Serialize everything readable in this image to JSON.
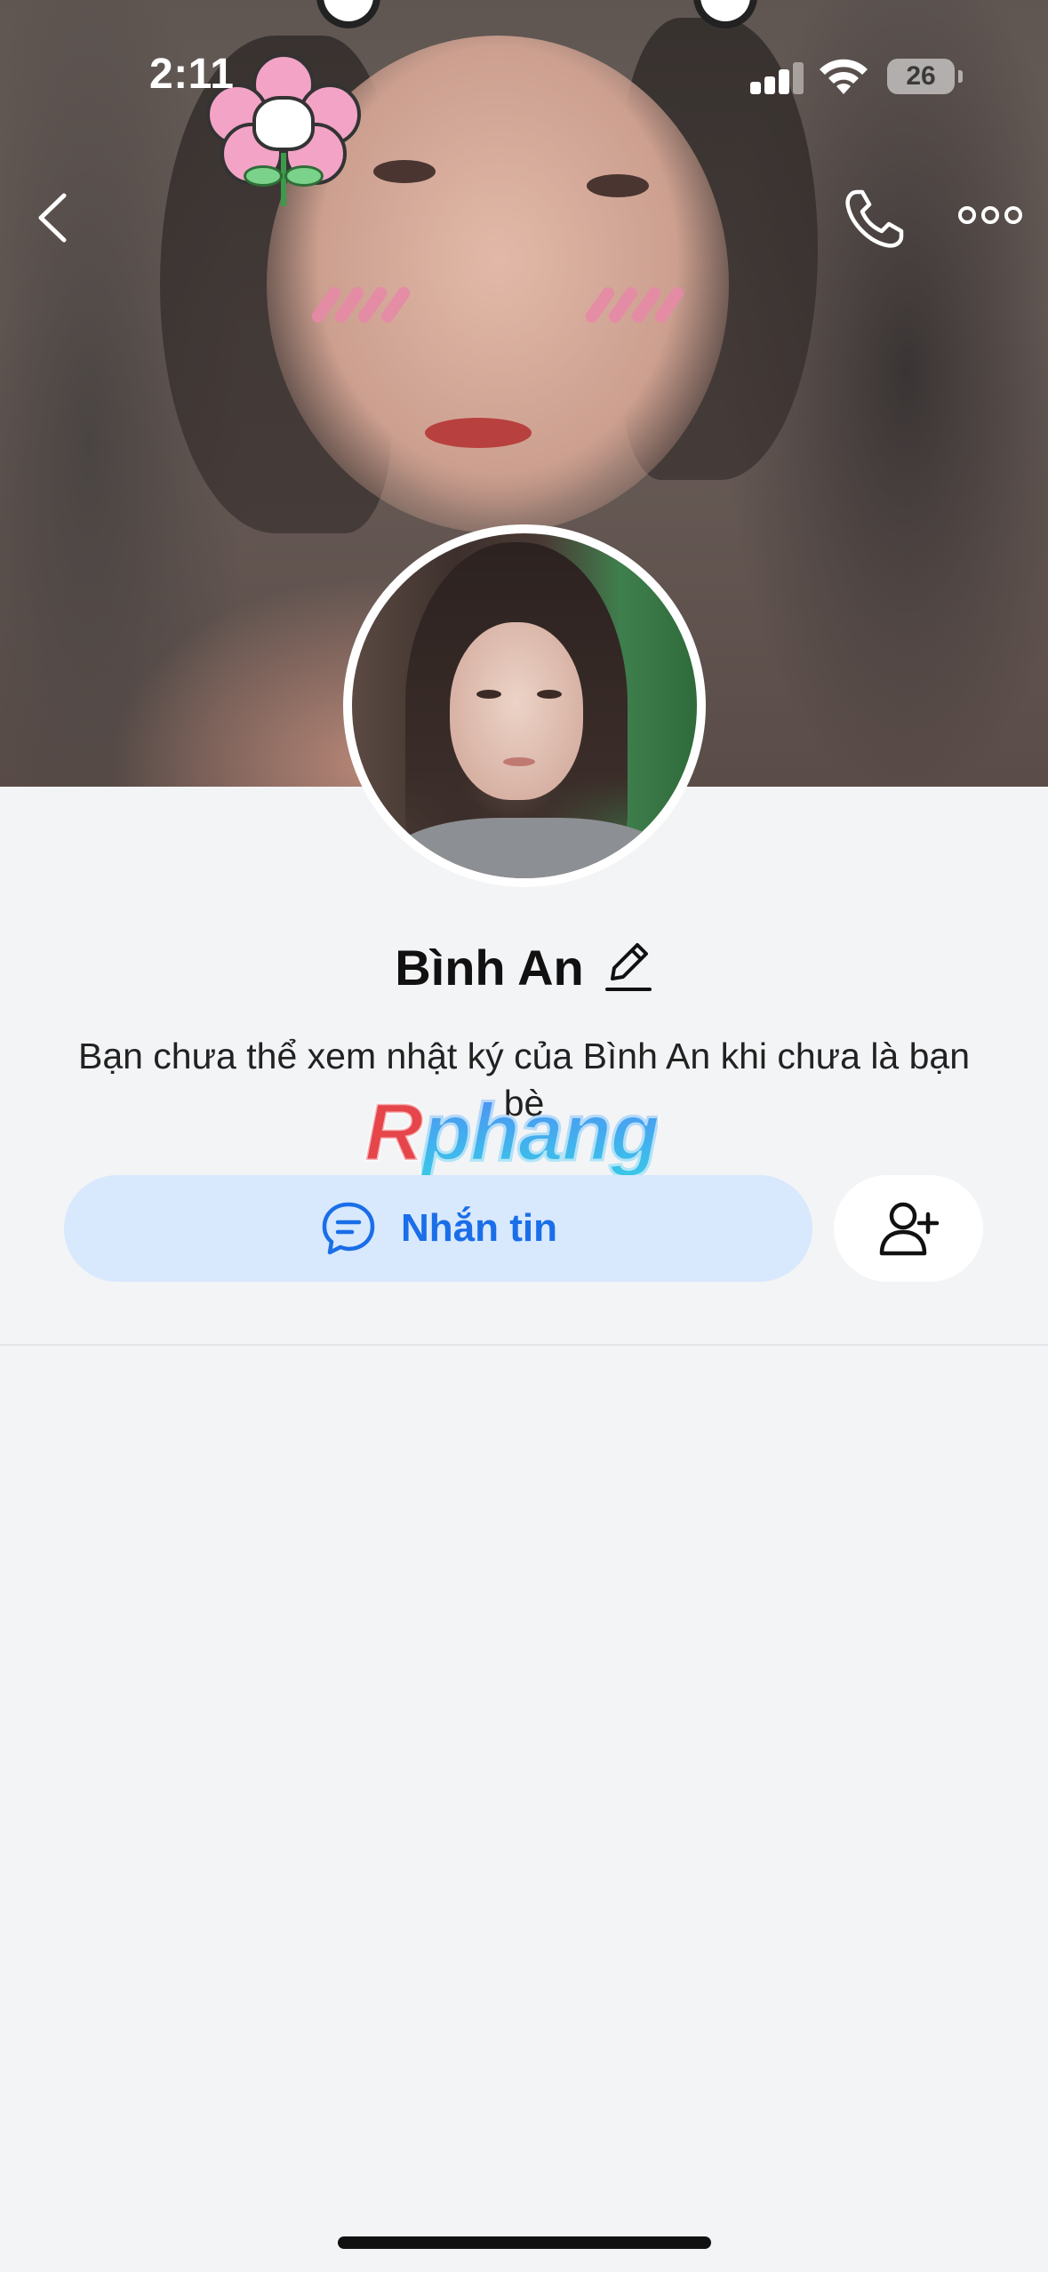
{
  "status_bar": {
    "time": "2:11",
    "battery": "26"
  },
  "profile": {
    "name": "Bình An",
    "info_text": "Bạn chưa thể xem nhật ký của Bình An khi chưa là bạn bè"
  },
  "actions": {
    "message_label": "Nhắn tin"
  },
  "watermark": {
    "first": "R",
    "rest": "phang"
  },
  "icons": {
    "back": "chevron-left-icon",
    "call": "phone-icon",
    "more": "more-horizontal-icon",
    "edit": "pencil-icon",
    "message": "chat-bubble-icon",
    "add_friend": "user-plus-icon"
  },
  "colors": {
    "accent": "#1a6ee8",
    "message_button_bg": "#d8e8fd",
    "page_bg": "#f3f4f6"
  }
}
